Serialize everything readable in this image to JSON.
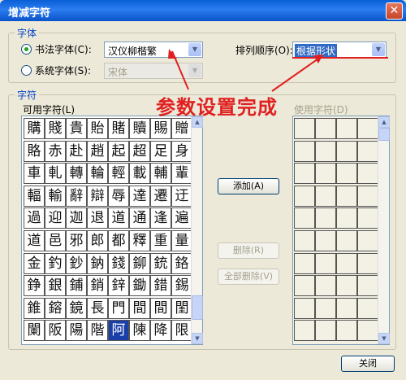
{
  "window": {
    "title": "增减字符",
    "close_glyph": "✕"
  },
  "font_group": {
    "label": "字体",
    "calligraphy": {
      "label": "书法字体(C):",
      "value": "汉仪柳楷繁",
      "checked": true
    },
    "sort": {
      "label": "排列顺序(O):",
      "value": "根据形状"
    },
    "system": {
      "label": "系统字体(S):",
      "value": "宋体",
      "checked": false
    }
  },
  "char_group": {
    "label": "字符",
    "available_label": "可用字符(L)",
    "used_label": "使用字符(D)",
    "available_chars": [
      [
        "購",
        "賤",
        "貴",
        "貽",
        "賭",
        "贖",
        "賜",
        "贈"
      ],
      [
        "賂",
        "赤",
        "赴",
        "趙",
        "起",
        "超",
        "足",
        "身"
      ],
      [
        "車",
        "軋",
        "轉",
        "輪",
        "輕",
        "載",
        "輔",
        "輩"
      ],
      [
        "輻",
        "輸",
        "辭",
        "辯",
        "辱",
        "達",
        "遷",
        "迂"
      ],
      [
        "過",
        "迎",
        "迦",
        "退",
        "道",
        "通",
        "逢",
        "遍"
      ],
      [
        "道",
        "邑",
        "邪",
        "郎",
        "都",
        "釋",
        "重",
        "量"
      ],
      [
        "金",
        "釣",
        "鈔",
        "鈉",
        "錢",
        "鉚",
        "銃",
        "鉻"
      ],
      [
        "錚",
        "銀",
        "鋪",
        "銷",
        "鋅",
        "鋤",
        "錯",
        "錫"
      ],
      [
        "錐",
        "鎔",
        "鏡",
        "長",
        "門",
        "間",
        "間",
        "閨"
      ],
      [
        "闌",
        "阪",
        "陽",
        "階",
        "阿",
        "陳",
        "降",
        "限"
      ]
    ],
    "selected_char": "阿"
  },
  "buttons": {
    "add": "添加(A)",
    "delete": "删除(R)",
    "delete_all": "全部删除(V)",
    "close": "关闭"
  },
  "annotation": {
    "text": "参数设置完成",
    "color": "#e02020"
  }
}
